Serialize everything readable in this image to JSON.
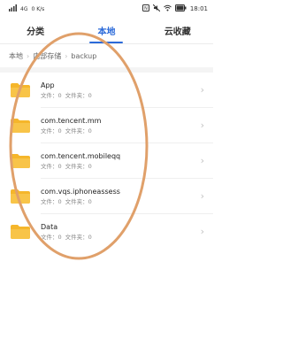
{
  "status_bar": {
    "carrier_signal": "4G",
    "net_speed": "0 K/s",
    "time": "18:01",
    "battery": "78"
  },
  "tabs": [
    {
      "label": "分类",
      "active": false
    },
    {
      "label": "本地",
      "active": true
    },
    {
      "label": "云收藏",
      "active": false
    }
  ],
  "breadcrumb": [
    "本地",
    "内部存储",
    "backup"
  ],
  "list": [
    {
      "name": "App",
      "file_label": "文件：0",
      "folder_label": "文件夹：0"
    },
    {
      "name": "com.tencent.mm",
      "file_label": "文件：0",
      "folder_label": "文件夹：0"
    },
    {
      "name": "com.tencent.mobileqq",
      "file_label": "文件：0",
      "folder_label": "文件夹：0"
    },
    {
      "name": "com.vqs.iphoneassess",
      "file_label": "文件：0",
      "folder_label": "文件夹：0"
    },
    {
      "name": "Data",
      "file_label": "文件：0",
      "folder_label": "文件夹：0"
    }
  ],
  "colors": {
    "accent": "#2b6ad9",
    "folder": "#f5b62b",
    "annotation": "#e0a06a"
  },
  "icons": {
    "folder": "folder-icon",
    "chevron": "chevron-right-icon"
  }
}
